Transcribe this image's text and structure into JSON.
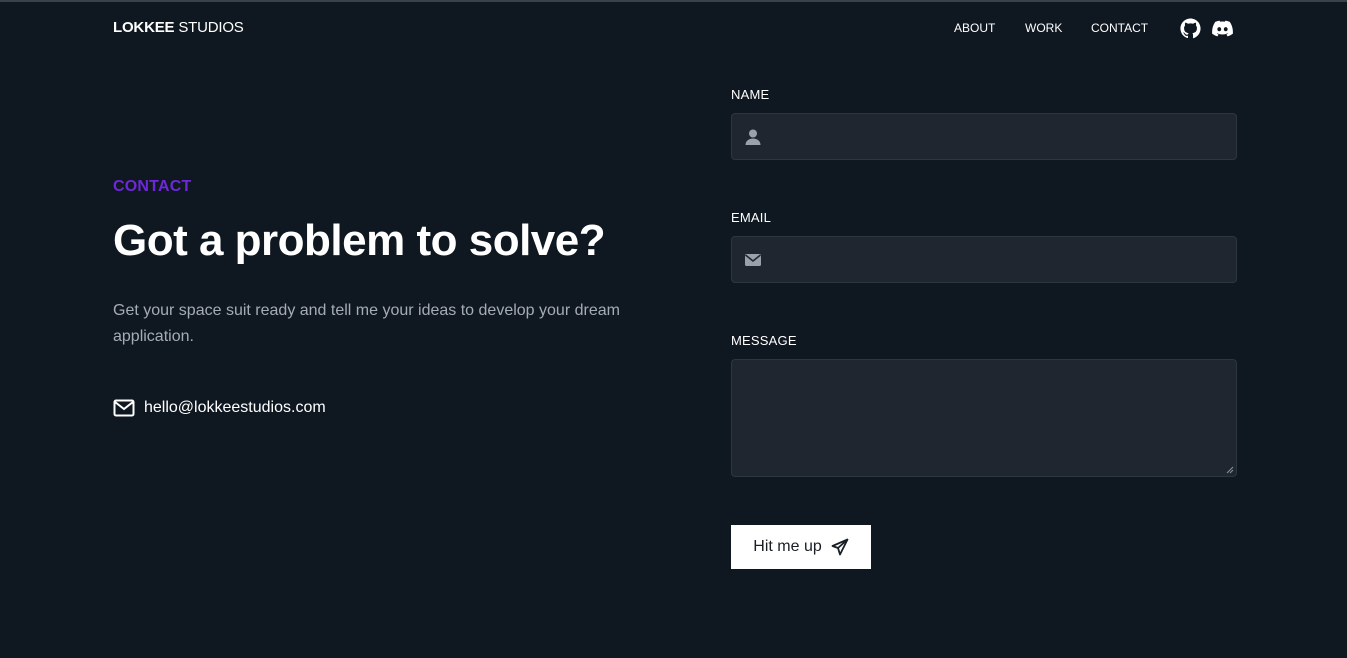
{
  "brand": {
    "bold": "LOKKEE",
    "light": "STUDIOS"
  },
  "nav": {
    "items": [
      {
        "label": "ABOUT"
      },
      {
        "label": "WORK"
      },
      {
        "label": "CONTACT"
      }
    ],
    "social": [
      {
        "icon": "github-icon"
      },
      {
        "icon": "discord-icon"
      }
    ]
  },
  "hero": {
    "eyebrow": "CONTACT",
    "title": "Got a problem to solve?",
    "lead": "Get your space suit ready and tell me your ideas to develop your dream application.",
    "email": "hello@lokkeestudios.com",
    "email_icon": "envelope-icon",
    "accent_color": "#6d28d9"
  },
  "form": {
    "name_label": "NAME",
    "name_value": "",
    "name_icon": "user-icon",
    "email_label": "EMAIL",
    "email_value": "",
    "email_icon": "envelope-icon",
    "message_label": "MESSAGE",
    "message_value": "",
    "submit_label": "Hit me up",
    "submit_icon": "paper-plane-icon"
  },
  "colors": {
    "background": "#0f1720",
    "field_background": "#1f2630",
    "button_background": "#ffffff"
  }
}
